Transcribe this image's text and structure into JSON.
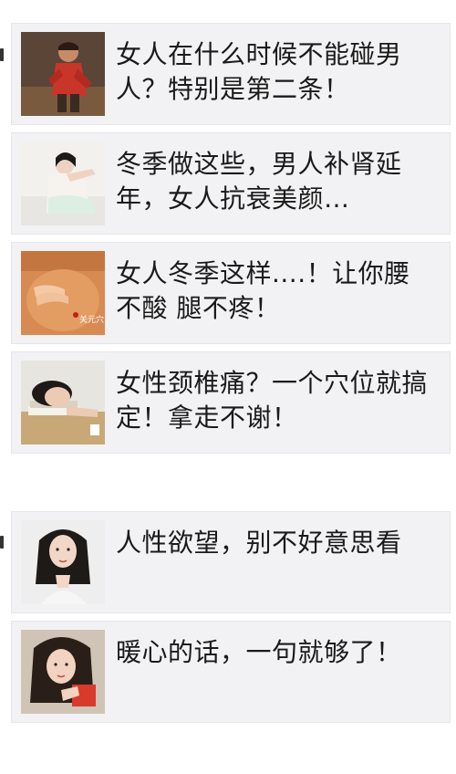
{
  "articles_group_1": [
    {
      "title": "女人在什么时候不能碰男人？特别是第二条！",
      "thumb_icon": "man-red-shirt-photo"
    },
    {
      "title": "冬季做这些，男人补肾延年，女人抗衰美颜…",
      "thumb_icon": "woman-lying-photo"
    },
    {
      "title": "女人冬季这样....！让你腰不酸 腿不疼！",
      "thumb_icon": "abdomen-massage-photo",
      "thumb_caption": "关元穴"
    },
    {
      "title": "女性颈椎痛？一个穴位就搞定！拿走不谢！",
      "thumb_icon": "woman-resting-on-books-photo"
    }
  ],
  "articles_group_2": [
    {
      "title": "人性欲望，别不好意思看",
      "thumb_icon": "woman-portrait-photo"
    },
    {
      "title": "暖心的话，一句就够了！",
      "thumb_icon": "woman-holding-book-photo"
    }
  ],
  "colors": {
    "card_bg": "#f2f2f4",
    "title_text": "#1a1a1a",
    "page_bg": "#ffffff"
  }
}
